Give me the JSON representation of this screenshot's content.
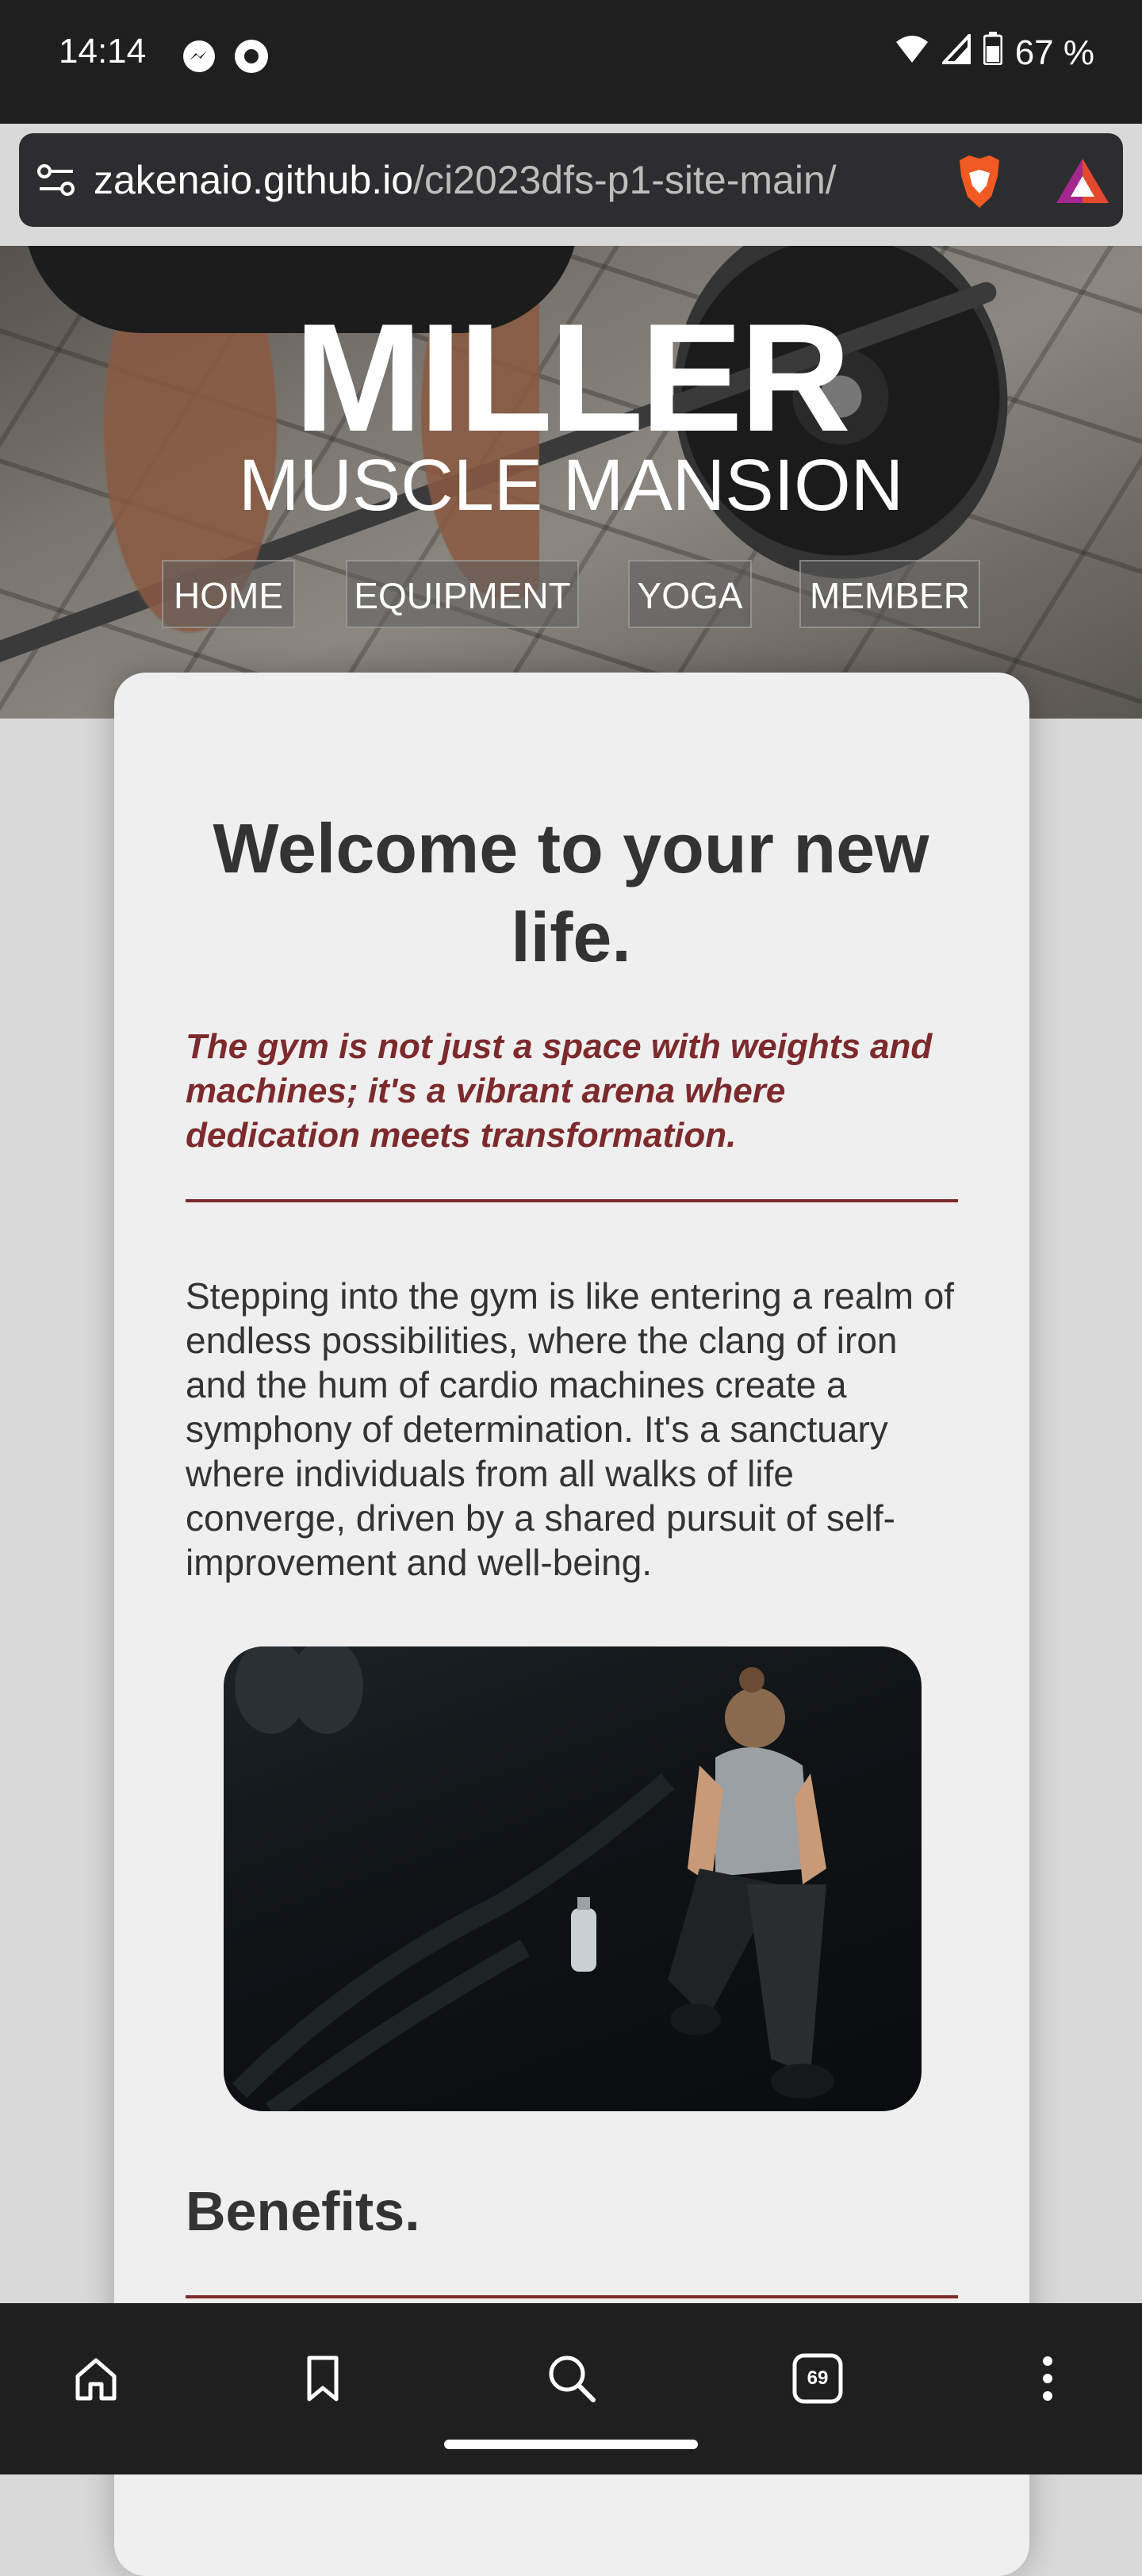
{
  "status_bar": {
    "time": "14:14",
    "battery": "67 %",
    "left_icons": [
      "messenger-icon",
      "circle-record-icon"
    ],
    "right_icons": [
      "wifi-icon",
      "cell-signal-icon",
      "battery-icon"
    ]
  },
  "browser": {
    "url_host": "zakenaio.github.io",
    "url_path": "/ci2023dfs-p1-site-main/",
    "icons": [
      "site-settings-icon",
      "brave-shields-icon",
      "brave-rewards-icon"
    ]
  },
  "hero": {
    "title": "MILLER",
    "subtitle": "MUSCLE MANSION",
    "nav": [
      "HOME",
      "EQUIPMENT",
      "YOGA",
      "MEMBER"
    ]
  },
  "content": {
    "heading": "Welcome to your new life.",
    "tagline": "The gym is not just a space with weights and machines; it's a vibrant arena where dedication meets transformation.",
    "body": "Stepping into the gym is like entering a realm of endless possibilities, where the clang of iron and the hum of cardio machines create a symphony of determination. It's a sanctuary where individuals from all walks of life converge, driven by a shared pursuit of self-improvement and well-being.",
    "section_heading": "Benefits."
  },
  "bottom_nav": {
    "tab_count": "69",
    "icons": [
      "home-icon",
      "bookmark-icon",
      "search-icon",
      "tabs-icon",
      "more-icon"
    ]
  },
  "colors": {
    "accent": "#7d2a2d",
    "text": "#333333",
    "card": "#efefef",
    "chrome": "#1f1f20"
  }
}
